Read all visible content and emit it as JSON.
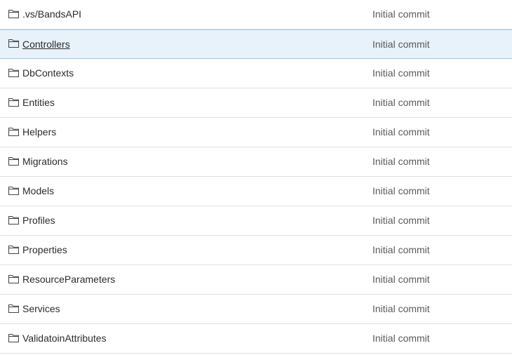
{
  "file_list": {
    "items": [
      {
        "name": ".vs/BandsAPI",
        "type_icon": "folder-icon",
        "last_commit": "Initial commit"
      },
      {
        "name": "Controllers",
        "type_icon": "folder-icon",
        "last_commit": "Initial commit",
        "selected": true
      },
      {
        "name": "DbContexts",
        "type_icon": "folder-icon",
        "last_commit": "Initial commit"
      },
      {
        "name": "Entities",
        "type_icon": "folder-icon",
        "last_commit": "Initial commit"
      },
      {
        "name": "Helpers",
        "type_icon": "folder-icon",
        "last_commit": "Initial commit"
      },
      {
        "name": "Migrations",
        "type_icon": "folder-icon",
        "last_commit": "Initial commit"
      },
      {
        "name": "Models",
        "type_icon": "folder-icon",
        "last_commit": "Initial commit"
      },
      {
        "name": "Profiles",
        "type_icon": "folder-icon",
        "last_commit": "Initial commit"
      },
      {
        "name": "Properties",
        "type_icon": "folder-icon",
        "last_commit": "Initial commit"
      },
      {
        "name": "ResourceParameters",
        "type_icon": "folder-icon",
        "last_commit": "Initial commit"
      },
      {
        "name": "Services",
        "type_icon": "folder-icon",
        "last_commit": "Initial commit"
      },
      {
        "name": "ValidatoinAttributes",
        "type_icon": "folder-icon",
        "last_commit": "Initial commit"
      }
    ]
  },
  "colors": {
    "selected_row_bg": "#e7f2fb",
    "selected_row_border": "#9fc9ec",
    "row_divider": "#dcdfe3",
    "text": "#2b2b2b",
    "commit_text": "#5a5a5a"
  }
}
